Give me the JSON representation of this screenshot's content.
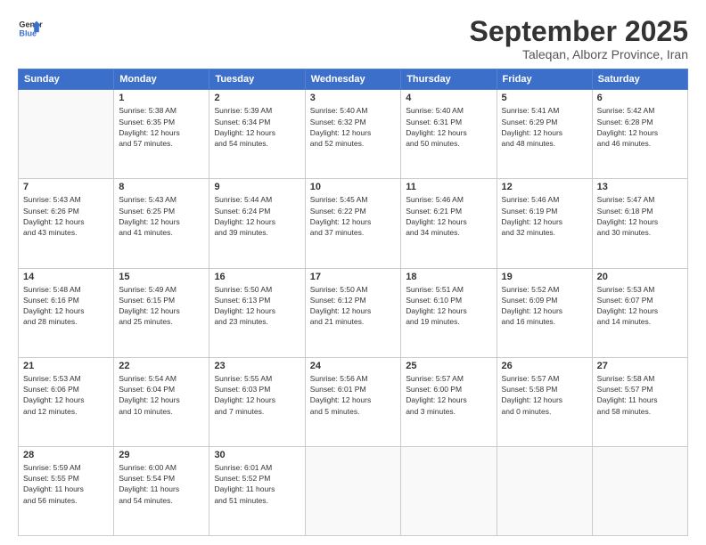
{
  "header": {
    "logo_line1": "General",
    "logo_line2": "Blue",
    "month": "September 2025",
    "location": "Taleqan, Alborz Province, Iran"
  },
  "weekdays": [
    "Sunday",
    "Monday",
    "Tuesday",
    "Wednesday",
    "Thursday",
    "Friday",
    "Saturday"
  ],
  "weeks": [
    [
      {
        "day": "",
        "info": ""
      },
      {
        "day": "1",
        "info": "Sunrise: 5:38 AM\nSunset: 6:35 PM\nDaylight: 12 hours\nand 57 minutes."
      },
      {
        "day": "2",
        "info": "Sunrise: 5:39 AM\nSunset: 6:34 PM\nDaylight: 12 hours\nand 54 minutes."
      },
      {
        "day": "3",
        "info": "Sunrise: 5:40 AM\nSunset: 6:32 PM\nDaylight: 12 hours\nand 52 minutes."
      },
      {
        "day": "4",
        "info": "Sunrise: 5:40 AM\nSunset: 6:31 PM\nDaylight: 12 hours\nand 50 minutes."
      },
      {
        "day": "5",
        "info": "Sunrise: 5:41 AM\nSunset: 6:29 PM\nDaylight: 12 hours\nand 48 minutes."
      },
      {
        "day": "6",
        "info": "Sunrise: 5:42 AM\nSunset: 6:28 PM\nDaylight: 12 hours\nand 46 minutes."
      }
    ],
    [
      {
        "day": "7",
        "info": "Sunrise: 5:43 AM\nSunset: 6:26 PM\nDaylight: 12 hours\nand 43 minutes."
      },
      {
        "day": "8",
        "info": "Sunrise: 5:43 AM\nSunset: 6:25 PM\nDaylight: 12 hours\nand 41 minutes."
      },
      {
        "day": "9",
        "info": "Sunrise: 5:44 AM\nSunset: 6:24 PM\nDaylight: 12 hours\nand 39 minutes."
      },
      {
        "day": "10",
        "info": "Sunrise: 5:45 AM\nSunset: 6:22 PM\nDaylight: 12 hours\nand 37 minutes."
      },
      {
        "day": "11",
        "info": "Sunrise: 5:46 AM\nSunset: 6:21 PM\nDaylight: 12 hours\nand 34 minutes."
      },
      {
        "day": "12",
        "info": "Sunrise: 5:46 AM\nSunset: 6:19 PM\nDaylight: 12 hours\nand 32 minutes."
      },
      {
        "day": "13",
        "info": "Sunrise: 5:47 AM\nSunset: 6:18 PM\nDaylight: 12 hours\nand 30 minutes."
      }
    ],
    [
      {
        "day": "14",
        "info": "Sunrise: 5:48 AM\nSunset: 6:16 PM\nDaylight: 12 hours\nand 28 minutes."
      },
      {
        "day": "15",
        "info": "Sunrise: 5:49 AM\nSunset: 6:15 PM\nDaylight: 12 hours\nand 25 minutes."
      },
      {
        "day": "16",
        "info": "Sunrise: 5:50 AM\nSunset: 6:13 PM\nDaylight: 12 hours\nand 23 minutes."
      },
      {
        "day": "17",
        "info": "Sunrise: 5:50 AM\nSunset: 6:12 PM\nDaylight: 12 hours\nand 21 minutes."
      },
      {
        "day": "18",
        "info": "Sunrise: 5:51 AM\nSunset: 6:10 PM\nDaylight: 12 hours\nand 19 minutes."
      },
      {
        "day": "19",
        "info": "Sunrise: 5:52 AM\nSunset: 6:09 PM\nDaylight: 12 hours\nand 16 minutes."
      },
      {
        "day": "20",
        "info": "Sunrise: 5:53 AM\nSunset: 6:07 PM\nDaylight: 12 hours\nand 14 minutes."
      }
    ],
    [
      {
        "day": "21",
        "info": "Sunrise: 5:53 AM\nSunset: 6:06 PM\nDaylight: 12 hours\nand 12 minutes."
      },
      {
        "day": "22",
        "info": "Sunrise: 5:54 AM\nSunset: 6:04 PM\nDaylight: 12 hours\nand 10 minutes."
      },
      {
        "day": "23",
        "info": "Sunrise: 5:55 AM\nSunset: 6:03 PM\nDaylight: 12 hours\nand 7 minutes."
      },
      {
        "day": "24",
        "info": "Sunrise: 5:56 AM\nSunset: 6:01 PM\nDaylight: 12 hours\nand 5 minutes."
      },
      {
        "day": "25",
        "info": "Sunrise: 5:57 AM\nSunset: 6:00 PM\nDaylight: 12 hours\nand 3 minutes."
      },
      {
        "day": "26",
        "info": "Sunrise: 5:57 AM\nSunset: 5:58 PM\nDaylight: 12 hours\nand 0 minutes."
      },
      {
        "day": "27",
        "info": "Sunrise: 5:58 AM\nSunset: 5:57 PM\nDaylight: 11 hours\nand 58 minutes."
      }
    ],
    [
      {
        "day": "28",
        "info": "Sunrise: 5:59 AM\nSunset: 5:55 PM\nDaylight: 11 hours\nand 56 minutes."
      },
      {
        "day": "29",
        "info": "Sunrise: 6:00 AM\nSunset: 5:54 PM\nDaylight: 11 hours\nand 54 minutes."
      },
      {
        "day": "30",
        "info": "Sunrise: 6:01 AM\nSunset: 5:52 PM\nDaylight: 11 hours\nand 51 minutes."
      },
      {
        "day": "",
        "info": ""
      },
      {
        "day": "",
        "info": ""
      },
      {
        "day": "",
        "info": ""
      },
      {
        "day": "",
        "info": ""
      }
    ]
  ]
}
